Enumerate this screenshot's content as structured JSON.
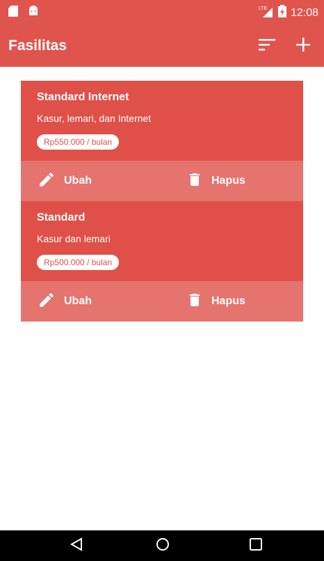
{
  "status_bar": {
    "network": "LTE",
    "time": "12:08"
  },
  "app_bar": {
    "title": "Fasilitas"
  },
  "facilities": [
    {
      "name": "Standard Internet",
      "description": "Kasur, lemari, dan Internet",
      "price": "Rp550.000 / bulan",
      "edit_label": "Ubah",
      "delete_label": "Hapus"
    },
    {
      "name": "Standard",
      "description": "Kasur dan lemari",
      "price": "Rp500.000 / bulan",
      "edit_label": "Ubah",
      "delete_label": "Hapus"
    }
  ],
  "colors": {
    "primary": "#e0544e",
    "card": "#df5049",
    "card_actions": "#e5746e",
    "nav_bar": "#000000"
  },
  "icons": [
    "sd-card-icon",
    "android-icon",
    "lte-signal-icon",
    "battery-charging-icon",
    "sort-icon",
    "add-icon",
    "pencil-icon",
    "trash-icon",
    "back-icon",
    "home-icon",
    "recents-icon"
  ]
}
